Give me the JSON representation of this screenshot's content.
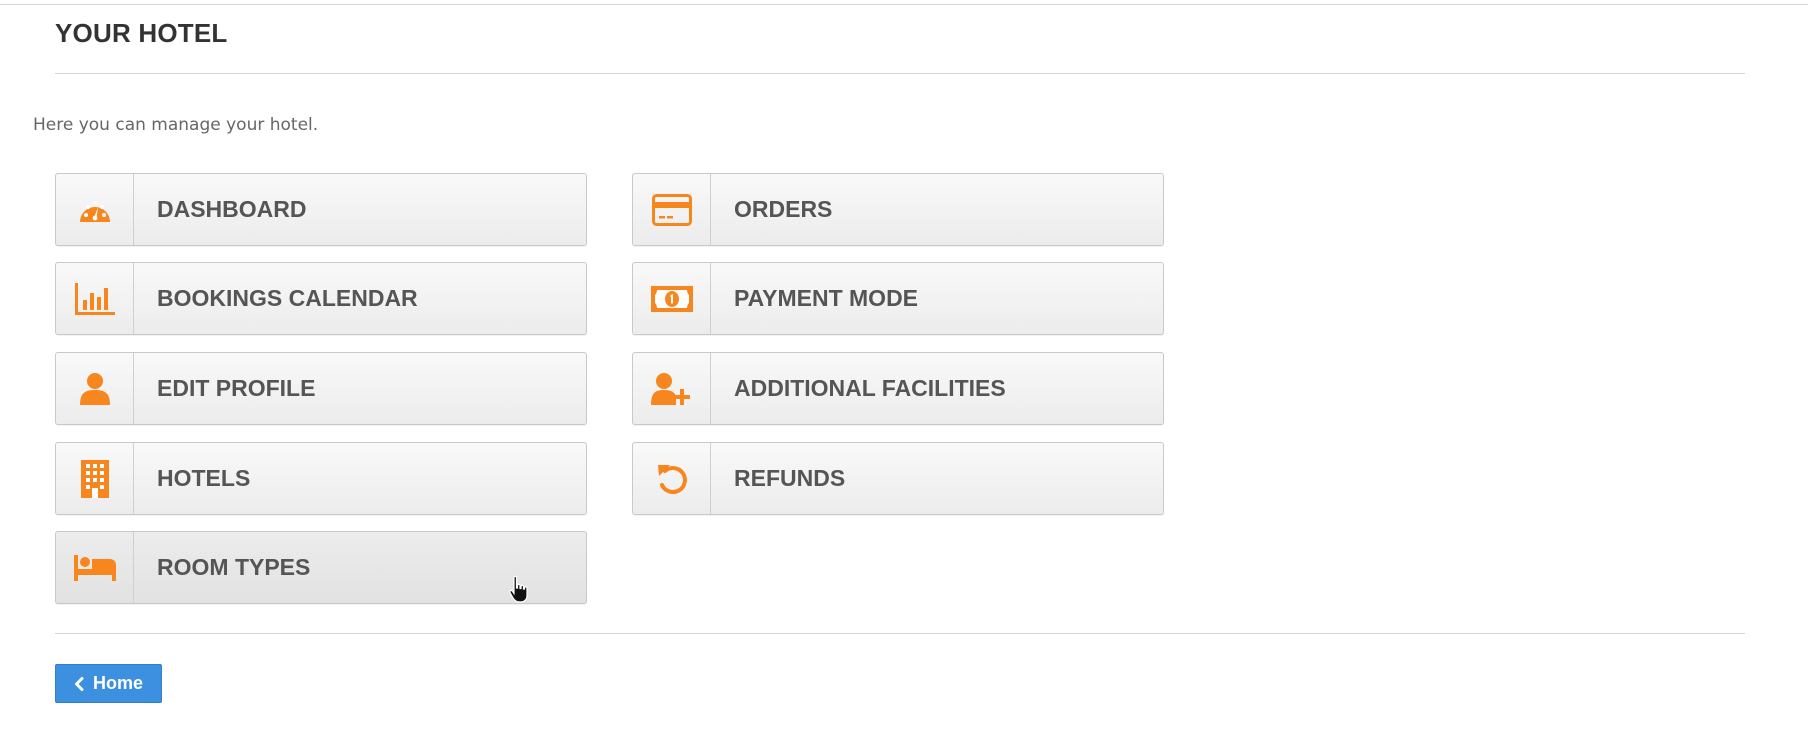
{
  "page": {
    "title": "YOUR HOTEL",
    "intro": "Here you can manage your hotel."
  },
  "accent_color": "#f7861e",
  "menu": {
    "left": [
      {
        "label": "DASHBOARD",
        "icon": "dashboard-icon"
      },
      {
        "label": "BOOKINGS CALENDAR",
        "icon": "bar-chart-icon"
      },
      {
        "label": "EDIT PROFILE",
        "icon": "user-icon"
      },
      {
        "label": "HOTELS",
        "icon": "building-icon"
      },
      {
        "label": "ROOM TYPES",
        "icon": "bed-icon"
      }
    ],
    "right": [
      {
        "label": "ORDERS",
        "icon": "credit-card-icon"
      },
      {
        "label": "PAYMENT MODE",
        "icon": "money-icon"
      },
      {
        "label": "ADDITIONAL FACILITIES",
        "icon": "user-plus-icon"
      },
      {
        "label": "REFUNDS",
        "icon": "undo-icon"
      }
    ]
  },
  "footer": {
    "home_label": "Home"
  }
}
